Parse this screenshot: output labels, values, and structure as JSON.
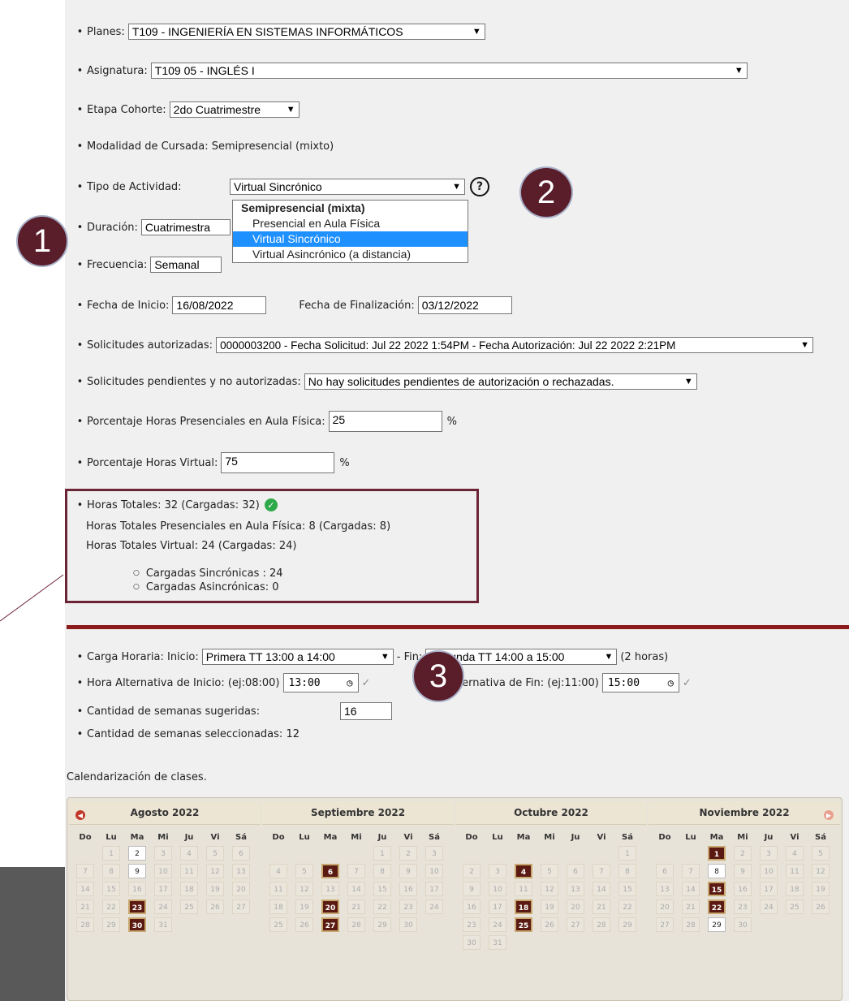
{
  "form": {
    "planes": {
      "label": "Planes:",
      "value": "T109 - INGENIERÍA EN SISTEMAS INFORMÁTICOS"
    },
    "asignatura": {
      "label": "Asignatura:",
      "value": "T109  05 - INGLÉS I"
    },
    "etapa": {
      "label": "Etapa Cohorte:",
      "value": "2do Cuatrimestre"
    },
    "modalidad": {
      "label": "Modalidad de Cursada: Semipresencial (mixto)"
    },
    "tipo": {
      "label": "Tipo de Actividad:",
      "value": "Virtual Sincrónico",
      "help": "?"
    },
    "tipo_options": {
      "group": "Semipresencial (mixta)",
      "opt1": "Presencial en Aula Física",
      "opt2": "Virtual Sincrónico",
      "opt3": "Virtual Asincrónico (a distancia)"
    },
    "duracion": {
      "label": "Duración:",
      "value": "Cuatrimestra"
    },
    "frecuencia": {
      "label": "Frecuencia:",
      "value": "Semanal"
    },
    "fecha_inicio": {
      "label": "Fecha de Inicio:",
      "value": "16/08/2022"
    },
    "fecha_fin": {
      "label": "Fecha de Finalización:",
      "value": "03/12/2022"
    },
    "solicitudes_aut": {
      "label": "Solicitudes autorizadas:",
      "value": "0000003200 - Fecha Solicitud: Jul 22 2022 1:54PM - Fecha Autorización: Jul 22 2022 2:21PM"
    },
    "solicitudes_pend": {
      "label": "Solicitudes pendientes y no autorizadas:",
      "value": "No hay solicitudes pendientes de autorización o rechazadas."
    },
    "pct_presencial": {
      "label": "Porcentaje Horas Presenciales en Aula Física:",
      "value": "25",
      "unit": "%"
    },
    "pct_virtual": {
      "label": "Porcentaje Horas Virtual:",
      "value": "75",
      "unit": "%"
    }
  },
  "hours": {
    "totales": "Horas Totales:  32 (Cargadas: 32)",
    "presenciales": "Horas Totales Presenciales en Aula Física:  8 (Cargadas: 8)",
    "virtual": "Horas Totales Virtual:  24 (Cargadas: 24)",
    "sincronicas": "Cargadas Sincrónicas : 24",
    "asincronicas": "Cargadas Asincrónicas: 0"
  },
  "carga": {
    "label": "Carga Horaria: Inicio:",
    "inicio": "Primera TT 13:00 a 14:00",
    "fin_label": "- Fin:",
    "fin": "Segunda TT 14:00 a 15:00",
    "duracion": "(2 horas)",
    "alt_inicio_label": "Hora Alternativa de Inicio: (ej:08:00)",
    "alt_inicio": "13:00",
    "alt_fin_label": "Hora Alternativa de Fin: (ej:11:00)",
    "alt_fin": "15:00",
    "semanas_sug_label": "Cantidad de semanas sugeridas:",
    "semanas_sug": "16",
    "semanas_sel": "Cantidad de semanas seleccionadas: 12"
  },
  "calendar": {
    "title": "Calendarización de clases.",
    "dow": [
      "Do",
      "Lu",
      "Ma",
      "Mi",
      "Ju",
      "Vi",
      "Sá"
    ],
    "months": [
      {
        "name": "Agosto 2022",
        "offset": 1,
        "days": 31,
        "enabled": [
          2,
          9
        ],
        "selected": [
          23,
          30
        ],
        "bordered": []
      },
      {
        "name": "Septiembre 2022",
        "offset": 4,
        "days": 30,
        "enabled": [],
        "selected": [
          6,
          20,
          27
        ],
        "bordered": []
      },
      {
        "name": "Octubre 2022",
        "offset": 6,
        "days": 31,
        "enabled": [],
        "selected": [
          4,
          18,
          25
        ],
        "bordered": []
      },
      {
        "name": "Noviembre 2022",
        "offset": 2,
        "days": 30,
        "enabled": [
          8,
          29
        ],
        "selected": [
          1,
          15,
          22
        ],
        "bordered": []
      }
    ]
  },
  "badges": {
    "b1": "1",
    "b2": "2",
    "b3": "3"
  },
  "colors": {
    "accent": "#5a1d2a",
    "divider": "#8b1a1a",
    "selected_day": "#5a1a12",
    "check_green": "#2eaa4a"
  }
}
